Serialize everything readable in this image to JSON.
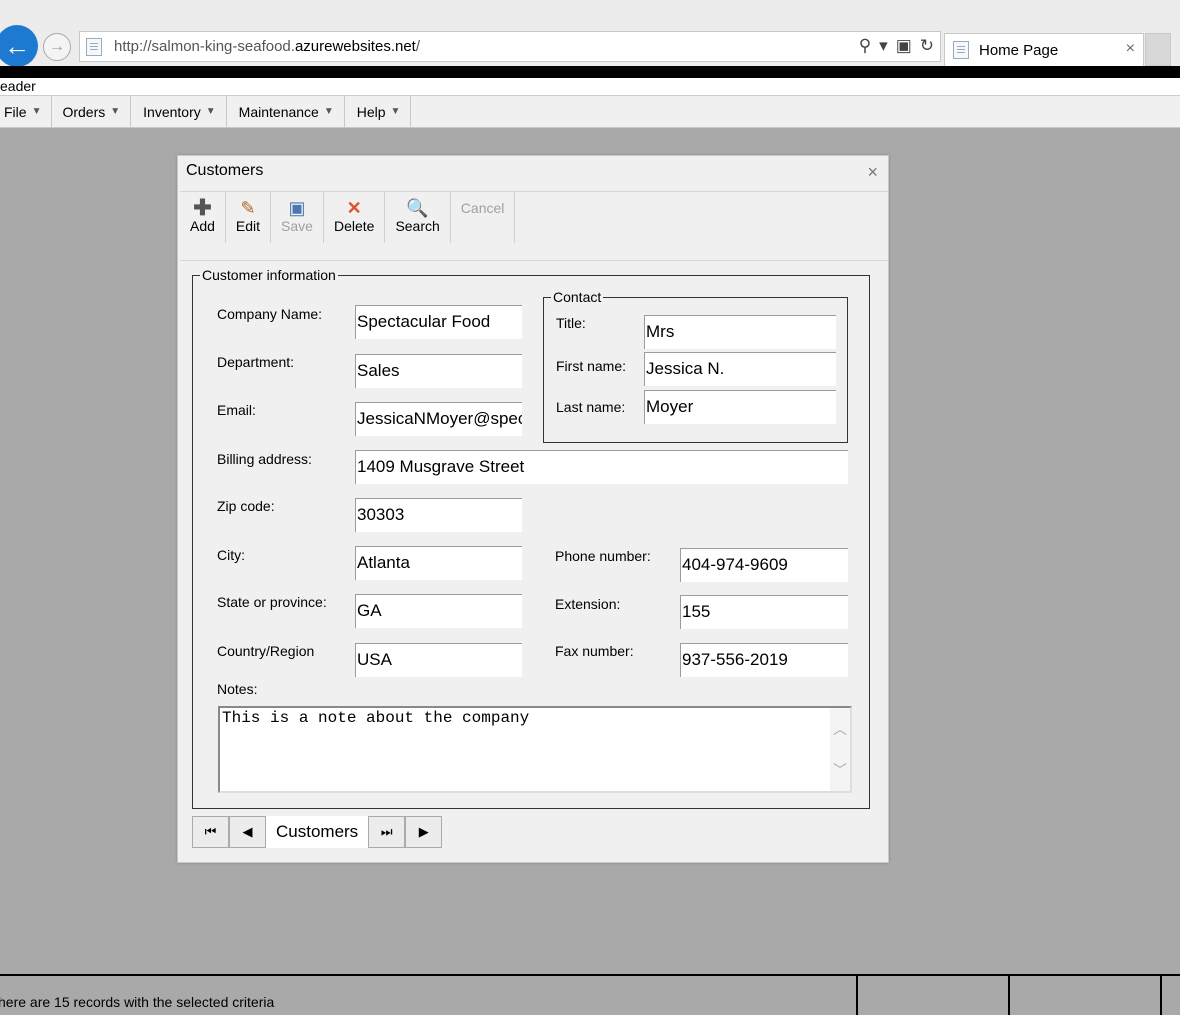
{
  "browser": {
    "url_prefix": "http://salmon-king-seafood.",
    "url_host": "azurewebsites.net",
    "url_suffix": "/",
    "tab_title": "Home Page",
    "back_icon": "←",
    "forward_icon": "→",
    "search_icon": "⚲",
    "dropdown_icon": "▾",
    "compat_icon": "▣",
    "refresh_icon": "↻",
    "close_icon": "×"
  },
  "header_text": "eader",
  "menu": [
    {
      "label": "File"
    },
    {
      "label": "Orders"
    },
    {
      "label": "Inventory"
    },
    {
      "label": "Maintenance"
    },
    {
      "label": "Help"
    }
  ],
  "dialog": {
    "title": "Customers",
    "close": "×",
    "toolbar": {
      "add": {
        "label": "Add",
        "icon": "✚"
      },
      "edit": {
        "label": "Edit",
        "icon": "✎"
      },
      "save": {
        "label": "Save",
        "icon": "▣"
      },
      "delete": {
        "label": "Delete",
        "icon": "✕"
      },
      "search": {
        "label": "Search",
        "icon": "🔍"
      },
      "cancel": {
        "label": "Cancel"
      }
    },
    "section_title": "Customer information",
    "contact_title": "Contact",
    "fields": {
      "company_name": {
        "label": "Company Name:",
        "value": "Spectacular Food"
      },
      "department": {
        "label": "Department:",
        "value": "Sales"
      },
      "email": {
        "label": "Email:",
        "value": "JessicaNMoyer@spec"
      },
      "billing_address": {
        "label": "Billing address:",
        "value": "1409 Musgrave Street"
      },
      "zip_code": {
        "label": "Zip code:",
        "value": "30303"
      },
      "city": {
        "label": "City:",
        "value": "Atlanta"
      },
      "state": {
        "label": "State or province:",
        "value": "GA"
      },
      "country": {
        "label": "Country/Region",
        "value": "USA"
      },
      "phone": {
        "label": "Phone number:",
        "value": "404-974-9609"
      },
      "extension": {
        "label": "Extension:",
        "value": "155"
      },
      "fax": {
        "label": "Fax number:",
        "value": "937-556-2019"
      },
      "title": {
        "label": "Title:",
        "value": "Mrs"
      },
      "first_name": {
        "label": "First name:",
        "value": "Jessica N."
      },
      "last_name": {
        "label": "Last name:",
        "value": "Moyer"
      },
      "notes": {
        "label": "Notes:",
        "value": "This is a note about the company"
      }
    },
    "nav": {
      "first": "⏮",
      "prev": "◀",
      "label": "Customers",
      "last": "⏭",
      "next": "▶"
    }
  },
  "status": {
    "text": "here are 15 records with the selected criteria"
  }
}
